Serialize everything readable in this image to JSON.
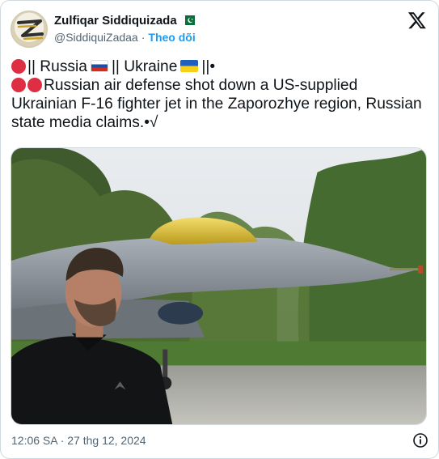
{
  "author": {
    "display_name": "Zulfiqar Siddiquizada",
    "handle": "@SiddiquiZadaa",
    "separator": "·",
    "follow_label": "Theo dõi",
    "verified_flag_icon": "pakistan-flag-icon"
  },
  "tweet": {
    "line1": {
      "prefix": "|| Russia",
      "middle": "|| Ukraine",
      "suffix": "||•"
    },
    "body": "Russian air defense shot down a US-supplied Ukrainian F-16 fighter jet in the Zaporozhye region, Russian state media claims.•√"
  },
  "meta": {
    "timestamp": "12:06 SA · 27 thg 12, 2024"
  },
  "icons": {
    "logo": "x-logo-icon",
    "info": "info-icon",
    "red_circle": "red-circle-icon",
    "russia_flag": "russia-flag-icon",
    "ukraine_flag": "ukraine-flag-icon"
  },
  "colors": {
    "link": "#1d9bf0",
    "secondary": "#536471",
    "red_circle": "#dd2e44"
  }
}
